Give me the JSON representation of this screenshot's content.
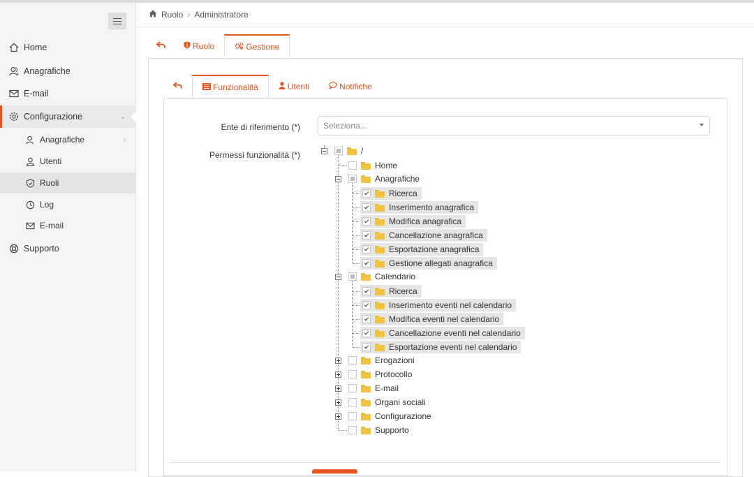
{
  "sidebar": {
    "items": [
      {
        "label": "Home",
        "icon": "home-icon"
      },
      {
        "label": "Anagrafiche",
        "icon": "users-icon"
      },
      {
        "label": "E-mail",
        "icon": "mail-icon"
      },
      {
        "label": "Configurazione",
        "icon": "gear-icon"
      },
      {
        "label": "Supporto",
        "icon": "lifebuoy-icon"
      }
    ],
    "subitems": [
      {
        "label": "Anagrafiche",
        "icon": "users-icon"
      },
      {
        "label": "Utenti",
        "icon": "user-icon"
      },
      {
        "label": "Ruoli",
        "icon": "shield-icon"
      },
      {
        "label": "Log",
        "icon": "clock-icon"
      },
      {
        "label": "E-mail",
        "icon": "mail-icon"
      }
    ]
  },
  "breadcrumb": {
    "root": "Ruolo",
    "current": "Administratore"
  },
  "tabs": {
    "ruolo": "Ruolo",
    "gestione": "Gestione"
  },
  "subtabs": {
    "funzionalita": "Funzionalità",
    "utenti": "Utenti",
    "notifiche": "Notifiche"
  },
  "form": {
    "ente_label": "Ente di riferimento (*)",
    "ente_placeholder": "Seleziona...",
    "permessi_label": "Permessi funzionalità (*)"
  },
  "tree": {
    "root": "/",
    "home": "Home",
    "anagrafiche": "Anagrafiche",
    "anagrafiche_children": [
      "Ricerca",
      "Inserimento anagrafica",
      "Modifica anagrafica",
      "Cancellazione anagrafica",
      "Esportazione anagrafica",
      "Gestione allegati anagrafica"
    ],
    "calendario": "Calendario",
    "calendario_children": [
      "Ricerca",
      "Inserimento eventi nel calendario",
      "Modifica eventi nel calendario",
      "Cancellazione eventi nel calendario",
      "Esportazione eventi nel calendario"
    ],
    "collapsed": [
      "Erogazioni",
      "Protocollo",
      "E-mail",
      "Organi sociali",
      "Configurazione"
    ],
    "last": "Supporto"
  },
  "colors": {
    "accent": "#e8531f",
    "folder": "#efc442"
  }
}
